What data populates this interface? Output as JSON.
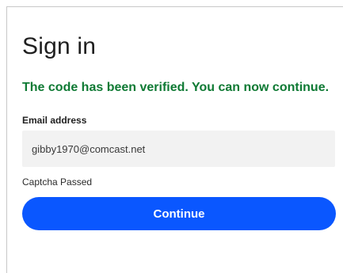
{
  "form": {
    "title": "Sign in",
    "success_message": "The code has been verified. You can now continue.",
    "email_label": "Email address",
    "email_value": "gibby1970@comcast.net",
    "captcha_status": "Captcha Passed",
    "continue_label": "Continue"
  },
  "colors": {
    "success": "#0f7a34",
    "primary_button": "#0a57ff"
  }
}
